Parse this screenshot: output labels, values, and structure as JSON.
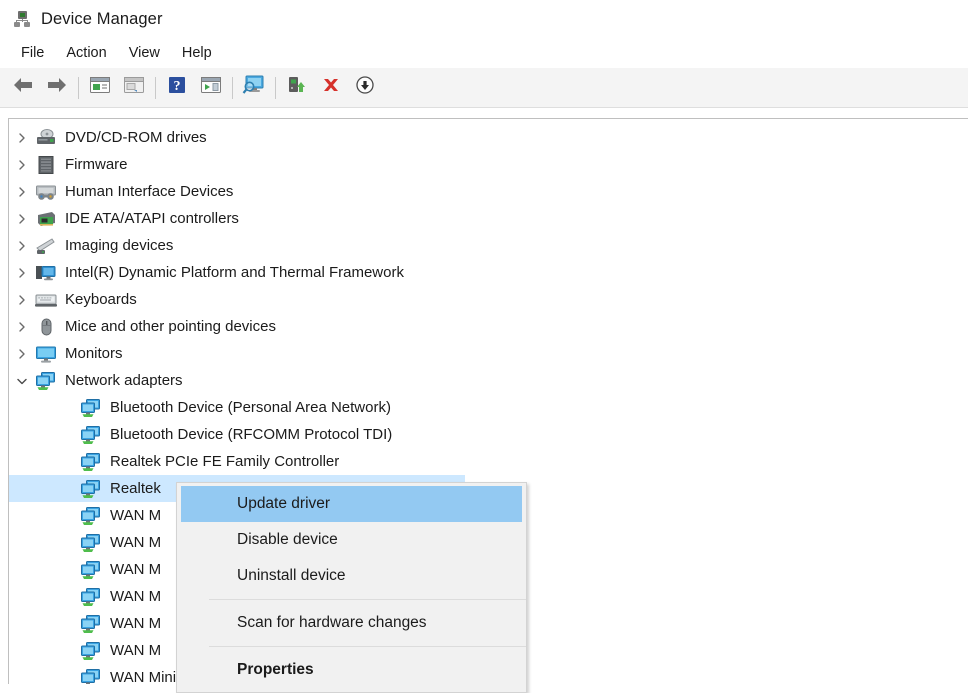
{
  "window": {
    "title": "Device Manager",
    "app_icon": "device-manager-icon"
  },
  "menubar": {
    "items": [
      {
        "label": "File"
      },
      {
        "label": "Action"
      },
      {
        "label": "View"
      },
      {
        "label": "Help"
      }
    ]
  },
  "toolbar": {
    "buttons": [
      {
        "icon": "back-arrow-icon",
        "name": "back-button"
      },
      {
        "icon": "forward-arrow-icon",
        "name": "forward-button"
      },
      {
        "separator": true
      },
      {
        "icon": "properties-window-icon",
        "name": "properties-button"
      },
      {
        "icon": "help-window-icon",
        "name": "show-hide-console-tree-button"
      },
      {
        "separator": true
      },
      {
        "icon": "question-mark-icon",
        "name": "help-button"
      },
      {
        "icon": "play-window-icon",
        "name": "show-hide-action-pane-button"
      },
      {
        "separator": true
      },
      {
        "icon": "scan-monitor-icon",
        "name": "scan-for-hardware-changes-button"
      },
      {
        "separator": true
      },
      {
        "icon": "update-driver-icon",
        "name": "update-driver-button"
      },
      {
        "icon": "red-x-icon",
        "name": "uninstall-device-button"
      },
      {
        "icon": "disable-arrow-down-icon",
        "name": "disable-device-button"
      }
    ]
  },
  "tree": {
    "nodes": [
      {
        "label": "DVD/CD-ROM drives",
        "icon": "dvd-drive-icon",
        "expander": "collapsed",
        "level": 0
      },
      {
        "label": "Firmware",
        "icon": "firmware-icon",
        "expander": "collapsed",
        "level": 0
      },
      {
        "label": "Human Interface Devices",
        "icon": "hid-icon",
        "expander": "collapsed",
        "level": 0
      },
      {
        "label": "IDE ATA/ATAPI controllers",
        "icon": "ide-controller-icon",
        "expander": "collapsed",
        "level": 0
      },
      {
        "label": "Imaging devices",
        "icon": "imaging-device-icon",
        "expander": "collapsed",
        "level": 0
      },
      {
        "label": "Intel(R) Dynamic Platform and Thermal Framework",
        "icon": "thermal-framework-icon",
        "expander": "collapsed",
        "level": 0
      },
      {
        "label": "Keyboards",
        "icon": "keyboard-icon",
        "expander": "collapsed",
        "level": 0
      },
      {
        "label": "Mice and other pointing devices",
        "icon": "mouse-icon",
        "expander": "collapsed",
        "level": 0
      },
      {
        "label": "Monitors",
        "icon": "monitor-icon",
        "expander": "collapsed",
        "level": 0
      },
      {
        "label": "Network adapters",
        "icon": "network-adapter-icon",
        "expander": "expanded",
        "level": 0
      },
      {
        "label": "Bluetooth Device (Personal Area Network)",
        "icon": "network-adapter-icon",
        "expander": "none",
        "level": 1
      },
      {
        "label": "Bluetooth Device (RFCOMM Protocol TDI)",
        "icon": "network-adapter-icon",
        "expander": "none",
        "level": 1
      },
      {
        "label": "Realtek PCIe FE Family Controller",
        "icon": "network-adapter-icon",
        "expander": "none",
        "level": 1
      },
      {
        "label": "Realtek",
        "icon": "network-adapter-icon",
        "expander": "none",
        "level": 1,
        "selected": true
      },
      {
        "label": "WAN M",
        "icon": "network-adapter-icon",
        "expander": "none",
        "level": 1
      },
      {
        "label": "WAN M",
        "icon": "network-adapter-icon",
        "expander": "none",
        "level": 1
      },
      {
        "label": "WAN M",
        "icon": "network-adapter-icon",
        "expander": "none",
        "level": 1
      },
      {
        "label": "WAN M",
        "icon": "network-adapter-icon",
        "expander": "none",
        "level": 1
      },
      {
        "label": "WAN M",
        "icon": "network-adapter-icon",
        "expander": "none",
        "level": 1
      },
      {
        "label": "WAN M",
        "icon": "network-adapter-icon",
        "expander": "none",
        "level": 1
      },
      {
        "label": "WAN Miniport (PPTP)",
        "icon": "network-adapter-icon",
        "expander": "none",
        "level": 1
      }
    ]
  },
  "context_menu": {
    "items": [
      {
        "label": "Update driver",
        "highlighted": true,
        "bold": false
      },
      {
        "label": "Disable device",
        "highlighted": false,
        "bold": false
      },
      {
        "label": "Uninstall device",
        "highlighted": false,
        "bold": false
      },
      {
        "separator": true
      },
      {
        "label": "Scan for hardware changes",
        "highlighted": false,
        "bold": false
      },
      {
        "separator": true
      },
      {
        "label": "Properties",
        "highlighted": false,
        "bold": true
      }
    ]
  },
  "colors": {
    "selection_highlight": "#cde8ff",
    "menu_highlight": "#93c9f2",
    "toolbar_bg": "#f4f4f4",
    "menu_bg": "#f1f1f1",
    "accent_red": "#d6312b",
    "net_icon_blue": "#3aa3e3"
  }
}
